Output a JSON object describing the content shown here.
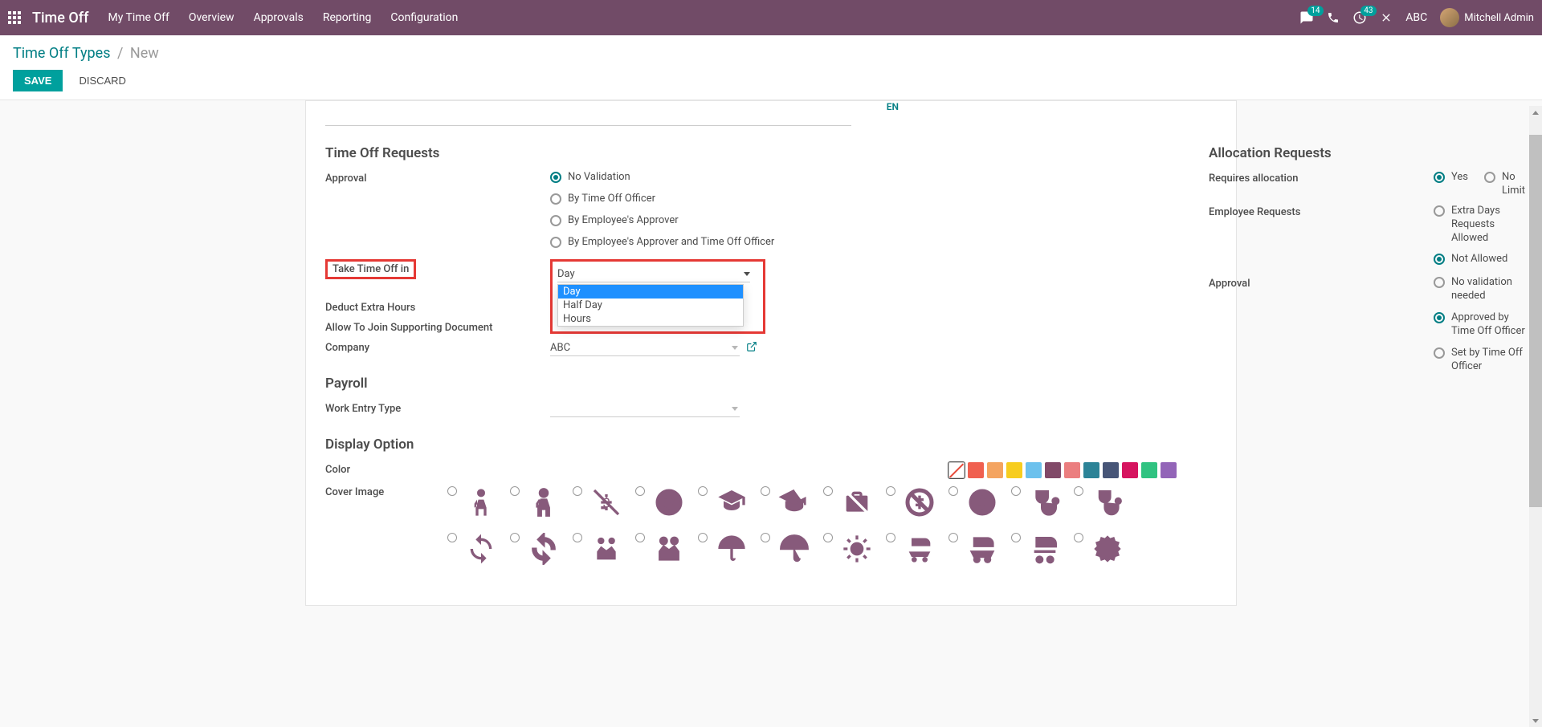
{
  "topbar": {
    "brand": "Time Off",
    "menu": [
      "My Time Off",
      "Overview",
      "Approvals",
      "Reporting",
      "Configuration"
    ],
    "msg_count": "14",
    "activity_count": "43",
    "company": "ABC",
    "user": "Mitchell Admin"
  },
  "breadcrumb": {
    "parent": "Time Off Types",
    "current": "New"
  },
  "buttons": {
    "save": "SAVE",
    "discard": "DISCARD"
  },
  "lang": "EN",
  "sections": {
    "time_off_requests": "Time Off Requests",
    "allocation_requests": "Allocation Requests",
    "payroll": "Payroll",
    "display_option": "Display Option"
  },
  "labels": {
    "approval": "Approval",
    "take_time_off_in": "Take Time Off in",
    "deduct_extra_hours": "Deduct Extra Hours",
    "allow_supporting_doc": "Allow To Join Supporting Document",
    "company": "Company",
    "work_entry_type": "Work Entry Type",
    "color": "Color",
    "cover_image": "Cover Image",
    "requires_allocation": "Requires allocation",
    "employee_requests": "Employee Requests",
    "alloc_approval": "Approval"
  },
  "approval_opts": [
    "No Validation",
    "By Time Off Officer",
    "By Employee's Approver",
    "By Employee's Approver and Time Off Officer"
  ],
  "unit_select": {
    "value": "Day",
    "options": [
      "Day",
      "Half Day",
      "Hours"
    ]
  },
  "company_value": "ABC",
  "requires_alloc_opts": [
    "Yes",
    "No Limit"
  ],
  "employee_req_opts": [
    "Extra Days Requests Allowed",
    "Not Allowed"
  ],
  "alloc_approval_opts": [
    "No validation needed",
    "Approved by Time Off Officer",
    "Set by Time Off Officer"
  ],
  "colors": [
    "#f06050",
    "#f4a460",
    "#f7cd1f",
    "#6cc1ed",
    "#814968",
    "#eb7e7f",
    "#2c8397",
    "#475577",
    "#d6145f",
    "#30c381",
    "#9365b8"
  ]
}
